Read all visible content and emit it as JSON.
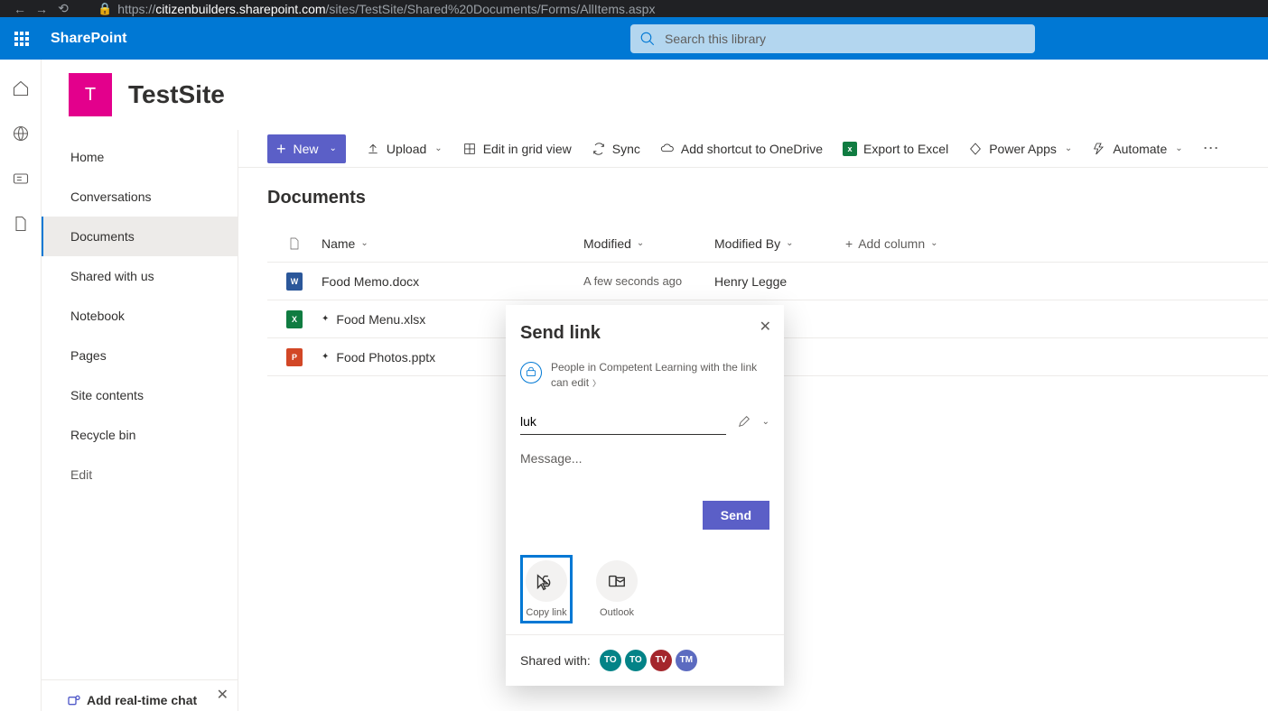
{
  "browser": {
    "url_prefix": "https://",
    "url_host": "citizenbuilders.sharepoint.com",
    "url_path": "/sites/TestSite/Shared%20Documents/Forms/AllItems.aspx"
  },
  "suite": {
    "app_name": "SharePoint",
    "search_placeholder": "Search this library"
  },
  "site": {
    "logo_letter": "T",
    "title": "TestSite"
  },
  "nav": {
    "items": [
      "Home",
      "Conversations",
      "Documents",
      "Shared with us",
      "Notebook",
      "Pages",
      "Site contents",
      "Recycle bin"
    ],
    "active_index": 2,
    "edit_label": "Edit"
  },
  "chat_promo": {
    "title": "Add real-time chat"
  },
  "commands": {
    "new": "New",
    "upload": "Upload",
    "grid": "Edit in grid view",
    "sync": "Sync",
    "shortcut": "Add shortcut to OneDrive",
    "excel": "Export to Excel",
    "powerapps": "Power Apps",
    "automate": "Automate"
  },
  "library": {
    "title": "Documents",
    "cols": {
      "name": "Name",
      "modified": "Modified",
      "modified_by": "Modified By",
      "add": "Add column"
    },
    "rows": [
      {
        "name": "Food Memo.docx",
        "type": "w",
        "new": false,
        "modified": "A few seconds ago",
        "by": "Henry Legge"
      },
      {
        "name": "Food Menu.xlsx",
        "type": "x",
        "new": true,
        "modified": "",
        "by": ""
      },
      {
        "name": "Food Photos.pptx",
        "type": "p",
        "new": true,
        "modified": "",
        "by": ""
      }
    ]
  },
  "dialog": {
    "title": "Send link",
    "permission": "People in Competent Learning with the link can edit",
    "recipient_value": "luk",
    "message_placeholder": "Message...",
    "send": "Send",
    "copy_link": "Copy link",
    "outlook": "Outlook",
    "shared_with": "Shared with:",
    "avatars": [
      {
        "txt": "TO",
        "color": "#038387"
      },
      {
        "txt": "TO",
        "color": "#038387"
      },
      {
        "txt": "TV",
        "color": "#a4262c"
      },
      {
        "txt": "TM",
        "color": "#5c6bc0"
      }
    ]
  }
}
